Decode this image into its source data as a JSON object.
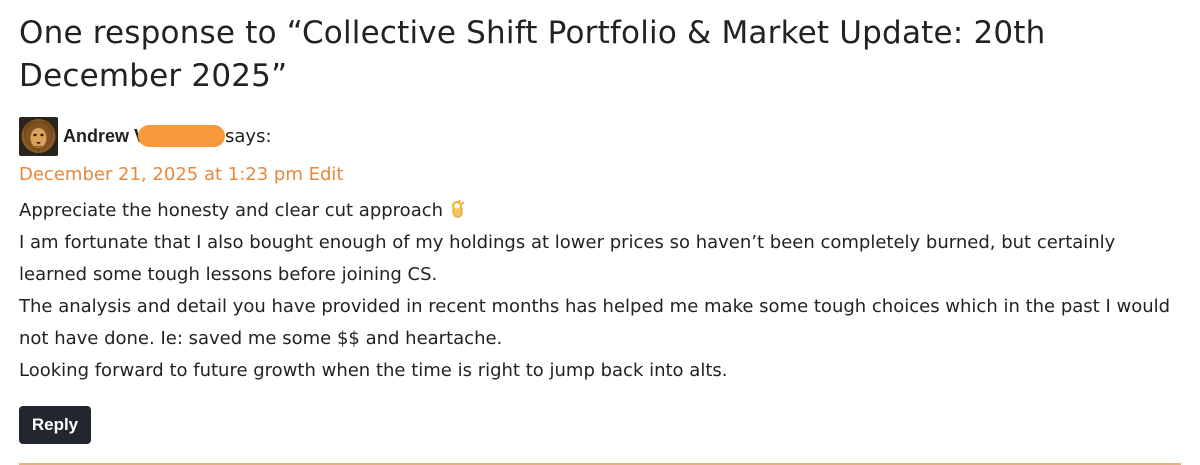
{
  "heading": {
    "text": "One response to “Collective Shift Portfolio & Market Update: 20th December 2025”"
  },
  "comment": {
    "author": "Andrew V",
    "says": "says:",
    "date": "December 21, 2025 at 1:23 pm",
    "edit_label": "Edit",
    "avatar_icon": "lion-avatar-icon",
    "redaction_color": "#f79a3c",
    "paragraphs": [
      "Appreciate the honesty and clear cut approach",
      "I am fortunate that I also bought enough of my holdings at lower prices so haven’t been completely burned, but certainly learned some tough lessons before joining CS.",
      "The analysis and detail you have provided in recent months has helped me make some tough choices which in the past I would not have done. Ie: saved me some $$ and heartache.",
      "Looking forward to future growth when the time is right to jump back into alts."
    ],
    "emoji_icon": "ok-hand-icon",
    "reply_label": "Reply"
  },
  "colors": {
    "accent": "#e8883a",
    "button_bg": "#22262e",
    "divider": "#e9b27c",
    "text": "#222222"
  }
}
